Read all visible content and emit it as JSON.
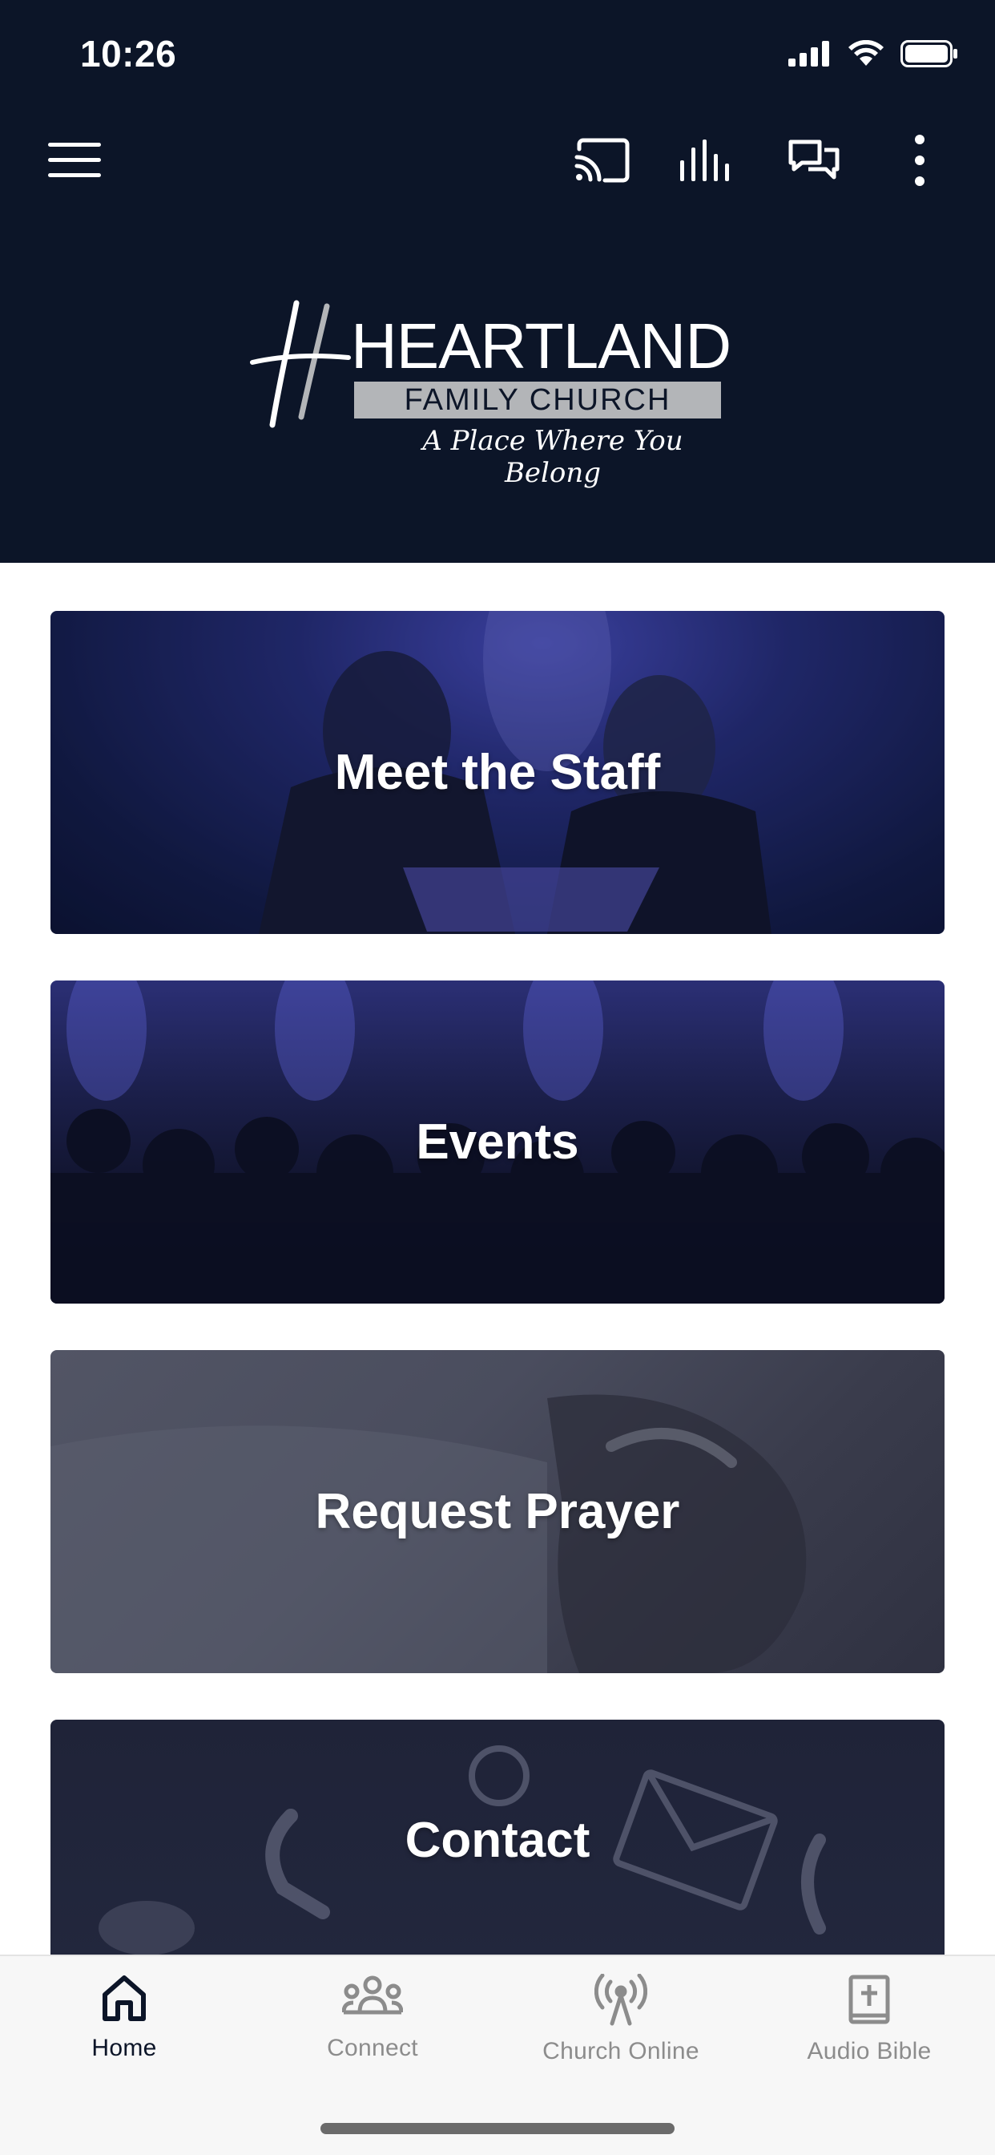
{
  "status_bar": {
    "time": "10:26"
  },
  "toolbar": {
    "menu_icon": "hamburger-menu-icon",
    "cast_icon": "cast-icon",
    "audio_icon": "audio-bars-icon",
    "chat_icon": "chat-bubbles-icon",
    "more_icon": "more-vertical-icon"
  },
  "logo": {
    "name": "HEARTLAND",
    "subtitle": "FAMILY CHURCH",
    "tagline": "A Place Where You Belong"
  },
  "cards": [
    {
      "title": "Meet the Staff"
    },
    {
      "title": "Events"
    },
    {
      "title": "Request Prayer"
    },
    {
      "title": "Contact"
    }
  ],
  "bottom_nav": {
    "items": [
      {
        "label": "Home",
        "icon": "home-icon",
        "active": true
      },
      {
        "label": "Connect",
        "icon": "group-icon",
        "active": false
      },
      {
        "label": "Church Online",
        "icon": "broadcast-icon",
        "active": false
      },
      {
        "label": "Audio Bible",
        "icon": "bible-icon",
        "active": false
      }
    ]
  },
  "colors": {
    "header_bg": "#0c1528",
    "active_nav": "#0c1528",
    "inactive_nav": "#8c8c8c"
  }
}
